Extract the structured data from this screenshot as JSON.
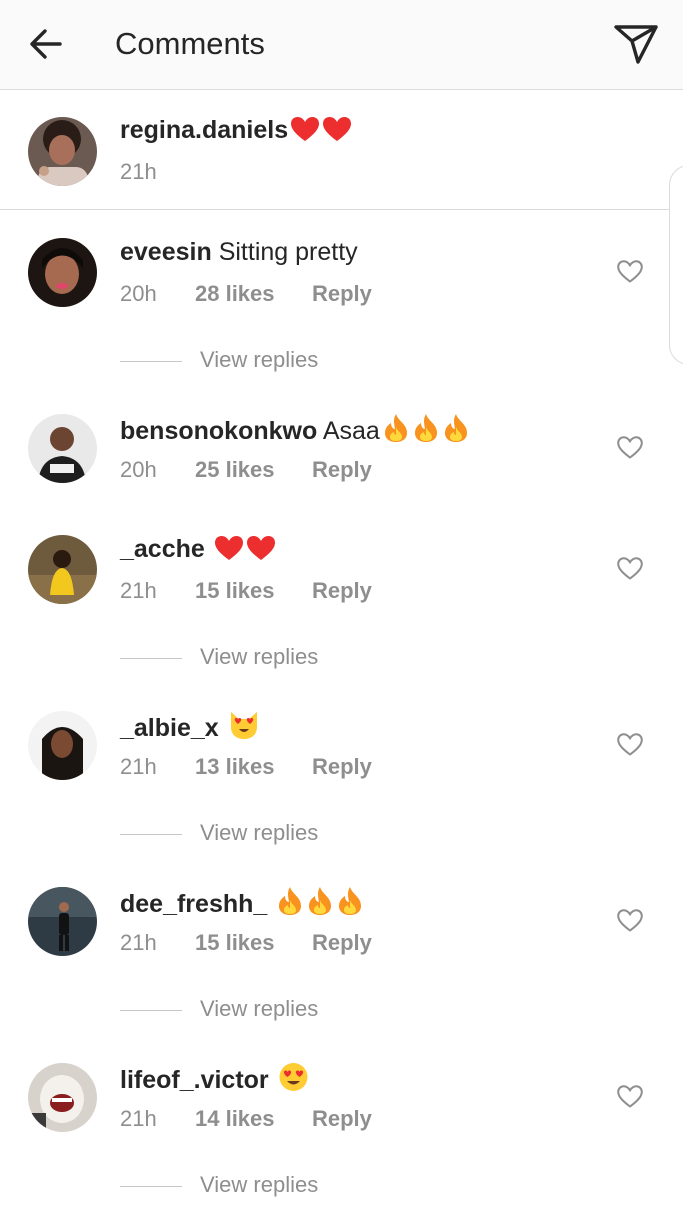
{
  "header": {
    "title": "Comments",
    "back_icon": "arrow-left-icon",
    "send_icon": "paper-plane-icon"
  },
  "caption": {
    "username": "regina.daniels",
    "text": "",
    "emoji": [
      "red-heart",
      "red-heart"
    ],
    "time": "21h"
  },
  "comments": [
    {
      "username": "eveesin",
      "text": "Sitting pretty",
      "emoji": [],
      "time": "20h",
      "likes": "28 likes",
      "reply": "Reply",
      "view_replies": "View replies"
    },
    {
      "username": "bensonokonkwo",
      "text": "Asaa",
      "emoji": [
        "fire",
        "fire",
        "fire"
      ],
      "time": "20h",
      "likes": "25 likes",
      "reply": "Reply",
      "view_replies": ""
    },
    {
      "username": "_acche",
      "text": "",
      "emoji": [
        "red-heart",
        "red-heart"
      ],
      "time": "21h",
      "likes": "15 likes",
      "reply": "Reply",
      "view_replies": "View replies"
    },
    {
      "username": "_albie_x",
      "text": "",
      "emoji": [
        "heart-eyes-cat"
      ],
      "time": "21h",
      "likes": "13 likes",
      "reply": "Reply",
      "view_replies": "View replies"
    },
    {
      "username": "dee_freshh_",
      "text": "",
      "emoji": [
        "fire",
        "fire",
        "fire"
      ],
      "time": "21h",
      "likes": "15 likes",
      "reply": "Reply",
      "view_replies": "View replies"
    },
    {
      "username": "lifeof_.victor",
      "text": "",
      "emoji": [
        "heart-eyes"
      ],
      "time": "21h",
      "likes": "14 likes",
      "reply": "Reply",
      "view_replies": "View replies"
    }
  ],
  "colors": {
    "text": "#262626",
    "secondary": "#8e8e8e",
    "divider": "#dbdbdb",
    "heart": "#ed2e2e",
    "fire": "#f7931e"
  }
}
